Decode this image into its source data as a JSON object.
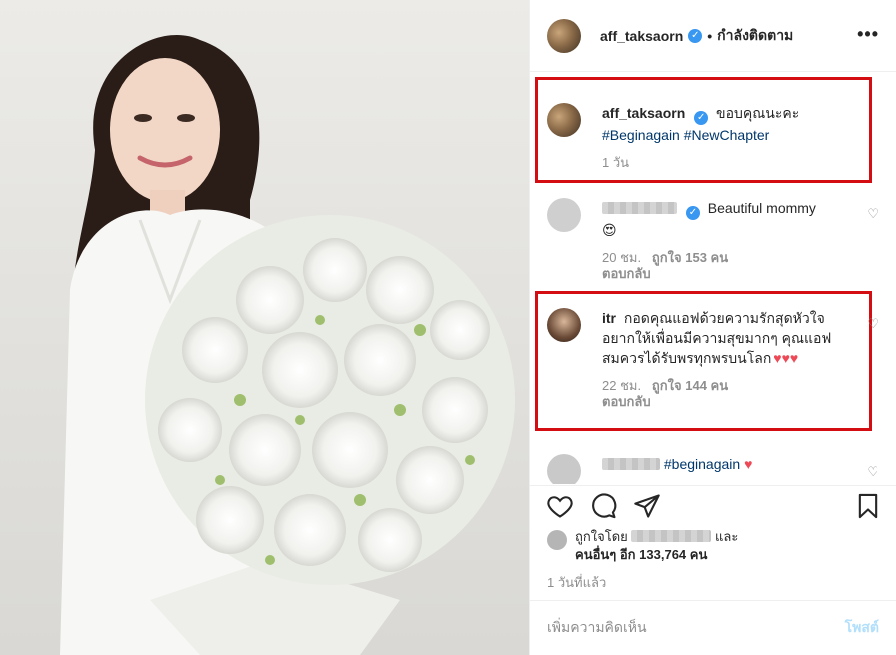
{
  "post": {
    "author": "aff_taksaorn",
    "follow_status": "กำลังติดตาม",
    "separator": "•",
    "more_icon": "more-horizontal-icon"
  },
  "caption": {
    "username": "aff_taksaorn",
    "text": "ขอบคุณนะคะ",
    "hashtags": "#Beginagain #NewChapter",
    "time": "1 วัน"
  },
  "comments": [
    {
      "text": "Beautiful mommy",
      "emoji": "😍",
      "time": "20 ชม.",
      "likes": "ถูกใจ 153 คน",
      "reply": "ตอบกลับ"
    },
    {
      "username": "itr",
      "text": "กอดคุณแอฟด้วยความรักสุดหัวใจ อยากให้เพื่อนมีความสุขมากๆ คุณแอฟสมควรได้รับพรทุกพรบนโลก",
      "hearts": "♥♥♥",
      "time": "22 ชม.",
      "likes": "ถูกใจ 144 คน",
      "reply": "ตอบกลับ"
    },
    {
      "text": "#beginagain",
      "heart": "♥"
    }
  ],
  "likes": {
    "prefix": "ถูกใจโดย",
    "and": "และ",
    "others": "คนอื่นๆ อีก 133,764 คน"
  },
  "timestamp": "1 วันที่แล้ว",
  "add_comment": {
    "placeholder": "เพิ่มความคิดเห็น",
    "post_label": "โพสต์"
  },
  "colors": {
    "highlight": "#d40d12",
    "link": "#00376b",
    "verified": "#3897f0",
    "muted": "#8e8e8e",
    "post_disabled": "#b2dffc"
  }
}
